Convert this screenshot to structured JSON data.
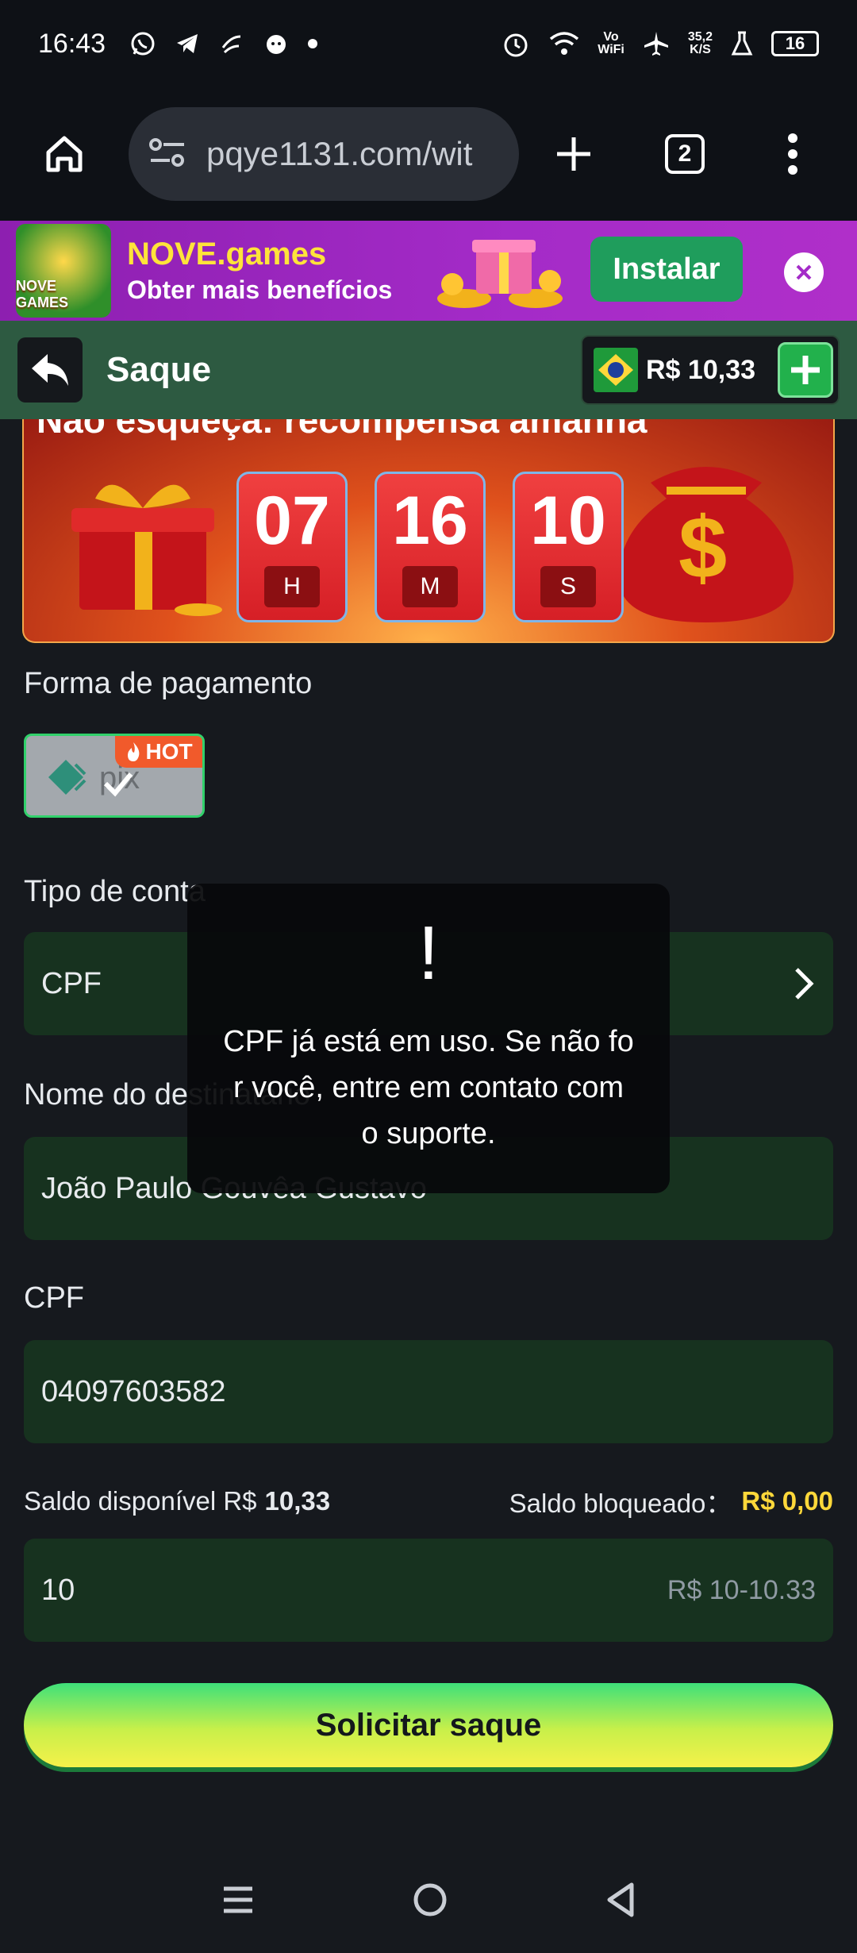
{
  "status_bar": {
    "time": "16:43",
    "wifi_label_top": "Vo",
    "wifi_label_bottom": "WiFi",
    "speed_top": "35,2",
    "speed_bottom": "K/S",
    "battery": "16"
  },
  "browser": {
    "url": "pqye1131.com/wit",
    "tab_count": "2"
  },
  "install_banner": {
    "logo_text": "NOVE GAMES",
    "title": "NOVE.games",
    "subtitle": "Obter mais benefícios",
    "install_label": "Instalar"
  },
  "header": {
    "title": "Saque",
    "balance": "R$ 10,33"
  },
  "promo": {
    "text": "Não esqueça: recompensa amanhã",
    "timer": [
      {
        "value": "07",
        "unit": "H"
      },
      {
        "value": "16",
        "unit": "M"
      },
      {
        "value": "10",
        "unit": "S"
      }
    ]
  },
  "form": {
    "payment_label": "Forma de pagamento",
    "payment_method": "pix",
    "hot_badge": "HOT",
    "account_type_label": "Tipo de conta",
    "account_type_value": "CPF",
    "recipient_label": "Nome do destinatário",
    "recipient_value": "João Paulo Gouvêa Gustavo",
    "cpf_label": "CPF",
    "cpf_value": "04097603582",
    "available_label": "Saldo disponível R$",
    "available_value": "10,33",
    "blocked_label": "Saldo bloqueado：",
    "blocked_value": "R$ 0,00",
    "amount_value": "10",
    "amount_hint": "R$ 10-10.33",
    "submit_label": "Solicitar saque"
  },
  "toast": {
    "icon": "!",
    "message": "CPF já está em uso. Se não for você, entre em contato com o suporte."
  },
  "colors": {
    "field_bg": "#17321f",
    "header_bg": "#2d5a41",
    "accent_yellow": "#ffd83a",
    "banner_purple": "#a42bc8"
  }
}
